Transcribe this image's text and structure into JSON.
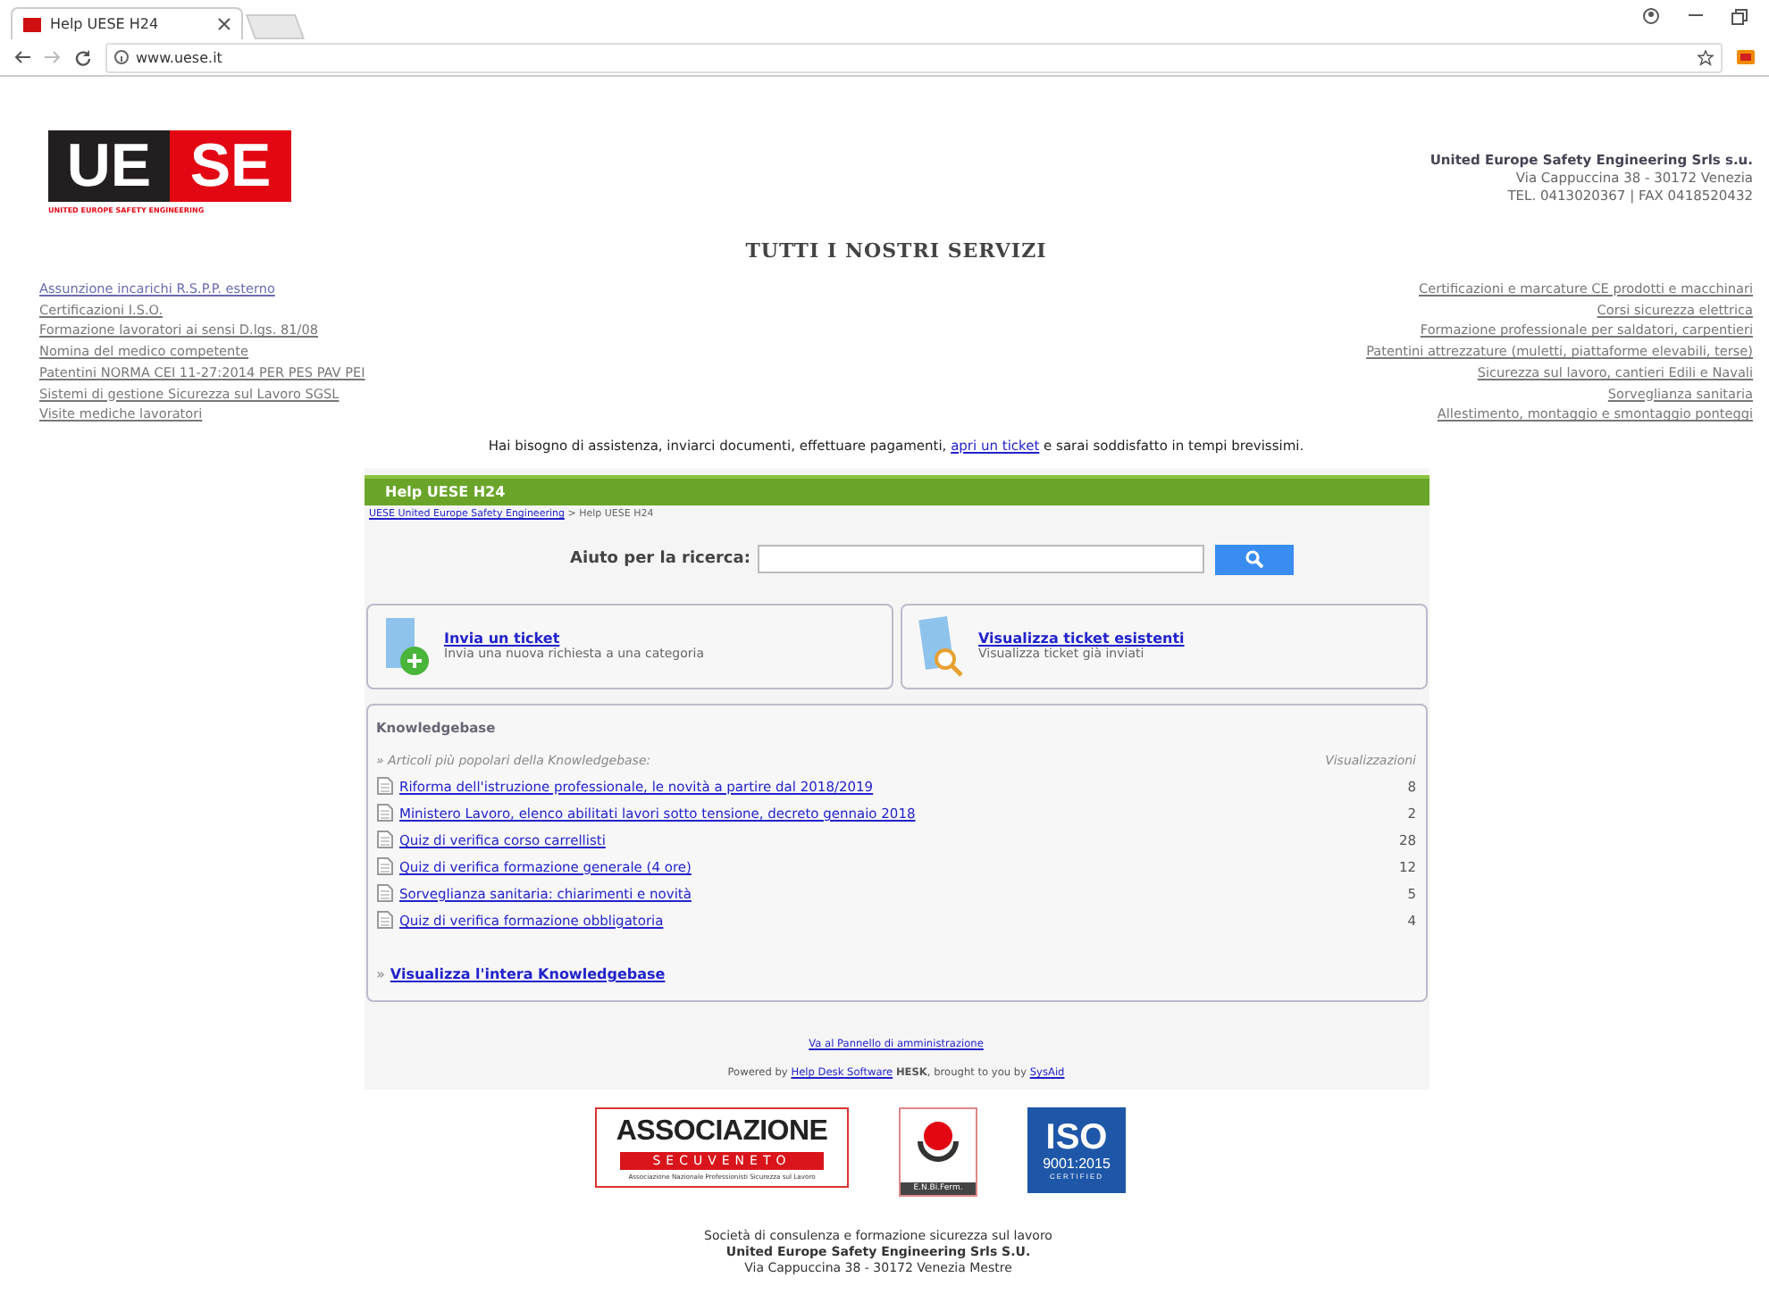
{
  "browser": {
    "tab_title": "Help UESE H24",
    "url": "www.uese.it"
  },
  "logo": {
    "left": "UE",
    "right": "SE",
    "tagline": "UNITED EUROPE SAFETY ENGINEERING"
  },
  "company": {
    "name": "United Europe Safety Engineering Srls s.u.",
    "address": "Via Cappuccina 38 - 30172 Venezia",
    "contacts": "TEL. 0413020367 | FAX 0418520432"
  },
  "services_title": "TUTTI I NOSTRI SERVIZI",
  "services_left": [
    "Assunzione incarichi R.S.P.P. esterno",
    "Certificazioni I.S.O.",
    "Formazione lavoratori ai sensi D.lgs. 81/08",
    "Nomina del medico competente",
    "Patentini NORMA CEI 11-27:2014 PER PES PAV PEI",
    "Sistemi di gestione Sicurezza sul Lavoro SGSL",
    "Visite mediche lavoratori"
  ],
  "services_right": [
    "Certificazioni e marcature CE prodotti e macchinari",
    "Corsi sicurezza elettrica",
    "Formazione professionale per saldatori, carpentieri",
    "Patentini attrezzature (muletti, piattaforme elevabili, terse)",
    "Sicurezza sul lavoro, cantieri Edili e Navali",
    "Sorveglianza sanitaria",
    "Allestimento, montaggio e smontaggio ponteggi"
  ],
  "assist": {
    "before": "Hai bisogno di assistenza, inviarci documenti, effettuare pagamenti,",
    "link": "apri un ticket",
    "after": "e sarai soddisfatto in tempi brevissimi."
  },
  "help": {
    "header": "Help UESE H24",
    "breadcrumb_link": "UESE United Europe Safety Engineering",
    "breadcrumb_rest": "> Help UESE H24",
    "search_label": "Aiuto per la ricerca:",
    "cards": [
      {
        "kind": "new",
        "title": "Invia un ticket",
        "subtitle": "Invia una nuova richiesta a una categoria"
      },
      {
        "kind": "view",
        "title": "Visualizza ticket esistenti",
        "subtitle": "Visualizza ticket già inviati"
      }
    ],
    "kb_title": "Knowledgebase",
    "kb_intro": "» Articoli più popolari della Knowledgebase:",
    "kb_views_header": "Visualizzazioni",
    "articles": [
      {
        "title": "Riforma dell'istruzione professionale, le novità a partire dal 2018/2019",
        "views": "8"
      },
      {
        "title": "Ministero Lavoro, elenco abilitati lavori sotto tensione, decreto gennaio 2018",
        "views": "2"
      },
      {
        "title": "Quiz di verifica corso carrellisti",
        "views": "28"
      },
      {
        "title": "Quiz di verifica formazione generale (4 ore)",
        "views": "12"
      },
      {
        "title": "Sorveglianza sanitaria: chiarimenti e novità",
        "views": "5"
      },
      {
        "title": "Quiz di verifica formazione obbligatoria",
        "views": "4"
      }
    ],
    "kb_all_prefix": "»",
    "kb_all": "Visualizza l'intera Knowledgebase",
    "admin_link": "Va al Pannello di amministrazione",
    "powered": {
      "p1": "Powered by",
      "l1": "Help Desk Software",
      "p2": "HESK",
      "p3": ", brought to you by",
      "l2": "SysAid"
    }
  },
  "badges": {
    "assoc_top": "ASSOCIAZIONE",
    "assoc_band": "SECUVENETO",
    "assoc_sub": "Associazione Nazionale Professionisti Sicurezza sul Lavoro",
    "enbi": "E.N.Bi.Ferm.",
    "iso_big": "ISO",
    "iso_num": "9001:2015",
    "iso_cert": "CERTIFIED"
  },
  "footer": [
    "Società di consulenza e formazione sicurezza sul lavoro",
    "United Europe Safety Engineering Srls S.U.",
    "Via Cappuccina 38 - 30172 Venezia Mestre"
  ]
}
